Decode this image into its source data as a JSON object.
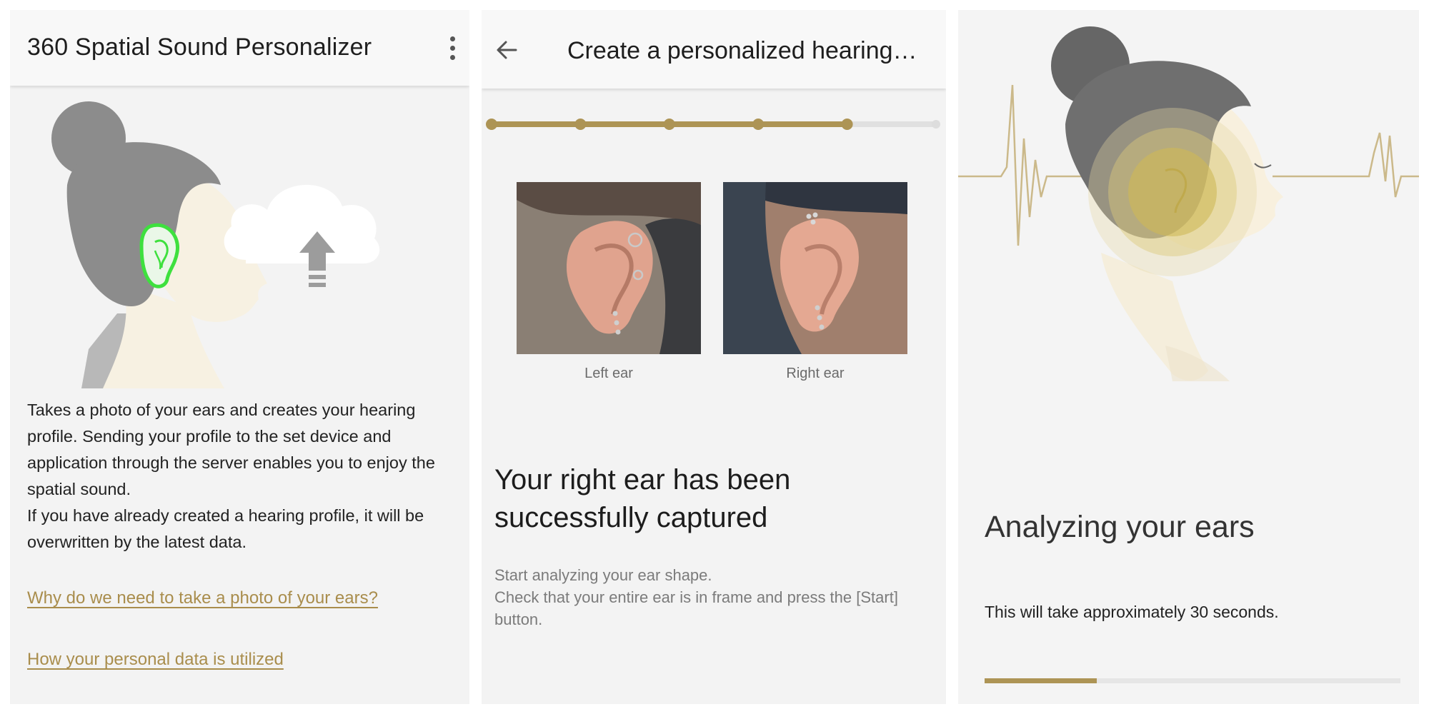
{
  "screen1": {
    "title": "360 Spatial Sound Personalizer",
    "menu_icon": "more-vert-icon",
    "illustration": "head-profile-with-cloud-upload",
    "paragraph1": "Takes a photo of your ears and creates your hearing profile. Sending your profile to the set device and application through the server enables you to enjoy the spatial sound.",
    "paragraph2": "If you have already created a hearing profile, it will be overwritten by the latest data.",
    "link_why": "Why do we need to take a photo of your ears?",
    "link_data": "How your personal data is utilized"
  },
  "screen2": {
    "back_icon": "arrow-back-icon",
    "title": "Create a personalized hearing…",
    "steps_total": 6,
    "steps_completed": 5,
    "left_caption": "Left ear",
    "right_caption": "Right ear",
    "headline": "Your right ear has been successfully captured",
    "instruction1": "Start analyzing your ear shape.",
    "instruction2": "Check that your entire ear is in frame and press the [Start] button."
  },
  "screen3": {
    "illustration": "head-profile-with-sound-wave",
    "status_title": "Analyzing your ears",
    "duration_text": "This will take approximately 30 seconds.",
    "progress": 0.27
  },
  "colors": {
    "accent": "#ad9455",
    "link": "#a98d4c",
    "panel_bg": "#f3f3f3",
    "highlight_ear": "#3ee03e"
  }
}
